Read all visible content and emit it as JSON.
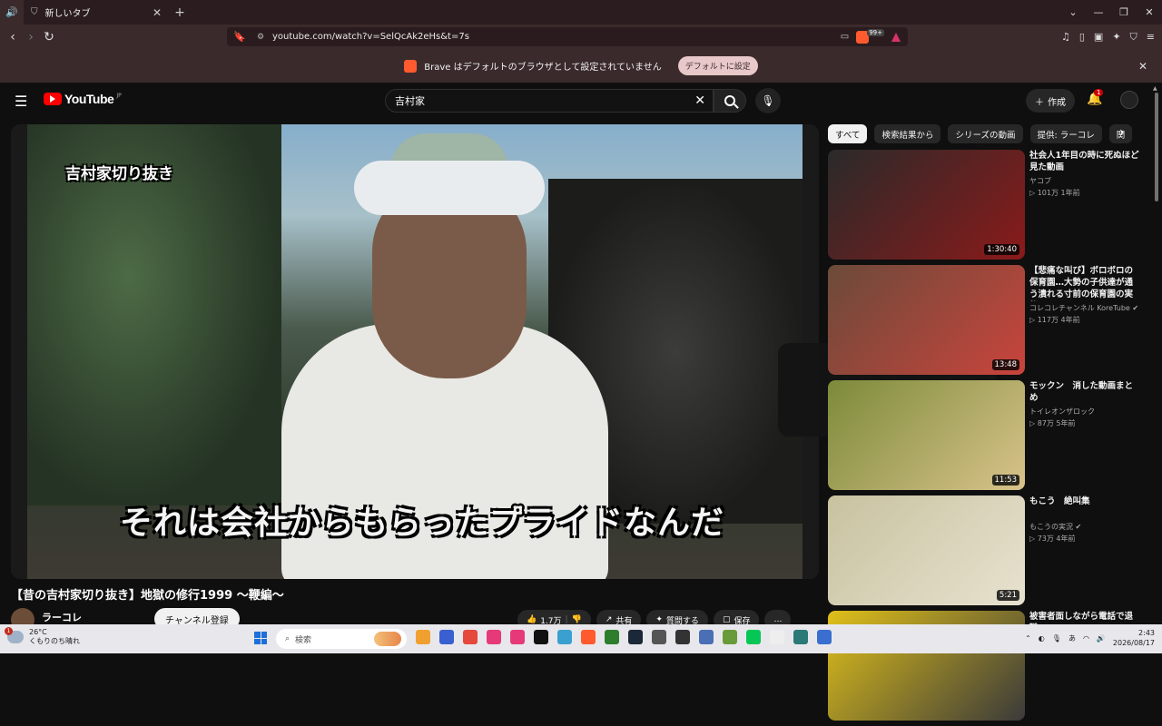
{
  "browser": {
    "tab_title": "新しいタブ",
    "url": "youtube.com/watch?v=SelQcAk2eHs&t=7s",
    "shield_count": "99+",
    "infobar_text": "Brave はデフォルトのブラウザとして設定されていません",
    "infobar_button": "デフォルトに設定"
  },
  "youtube": {
    "logo_text": "YouTube",
    "logo_region": "JP",
    "search_value": "吉村家",
    "create_label": "作成",
    "notification_count": "1"
  },
  "video": {
    "overlay_label": "吉村家切り抜き",
    "subtitle": "それは会社からもらったプライドなんだ",
    "title": "【昔の吉村家切り抜き】地獄の修行1999 〜鞭編〜",
    "channel": "ラーコレ",
    "subscribe_label": "チャンネル登録",
    "likes": "1.7万",
    "share_label": "共有",
    "ask_label": "質問する",
    "save_label": "保存",
    "more_label": "…"
  },
  "chips": [
    "すべて",
    "検索結果から",
    "シリーズの動画",
    "提供: ラーコレ",
    "関"
  ],
  "recommendations": [
    {
      "title": "社会人1年目の時に死ぬほど見た動画",
      "channel": "ヤコブ",
      "verified": false,
      "meta": "▷ 101万  1年前",
      "duration": "1:30:40",
      "colors": [
        "#2a2a2a",
        "#8b1a1a"
      ]
    },
    {
      "title": "【悲痛な叫び】ボロボロの保育園…大勢の子供達が通う潰れる寸前の保育園の実態に…",
      "channel": "コレコレチャンネル KoreTube",
      "verified": true,
      "meta": "▷ 117万  4年前",
      "duration": "13:48",
      "colors": [
        "#6b4a3a",
        "#c9443c"
      ]
    },
    {
      "title": "モックン　消した動画まとめ",
      "channel": "トイレオンザロック",
      "verified": false,
      "meta": "▷ 87万  5年前",
      "duration": "11:53",
      "colors": [
        "#7c8a3a",
        "#d9c38a"
      ]
    },
    {
      "title": "もこう　絶叫集",
      "channel": "もこうの実況",
      "verified": true,
      "meta": "▷ 73万  4年前",
      "duration": "5:21",
      "colors": [
        "#c8c2a0",
        "#e7e2cf"
      ]
    },
    {
      "title": "被害者面しながら電話で退職",
      "channel": "",
      "verified": false,
      "meta": "",
      "duration": "",
      "colors": [
        "#e0c01a",
        "#3a3a3a"
      ]
    }
  ],
  "taskbar": {
    "temperature": "26°C",
    "weather_text": "くもりのち晴れ",
    "weather_badge": "1",
    "search_placeholder": "検索",
    "time": "2:43",
    "date": "2026/08/17",
    "app_colors": [
      "#f0a030",
      "#3a5fd0",
      "#e5483c",
      "#e5397a",
      "#e5397a",
      "#111111",
      "#3aa0d0",
      "#ff5b2e",
      "#2d7d2d",
      "#1b2838",
      "#555555",
      "#333333",
      "#4a6fb5",
      "#6a9b3a",
      "#06c755",
      "#eeeeee",
      "#2b7a78",
      "#3a6fd0"
    ]
  }
}
